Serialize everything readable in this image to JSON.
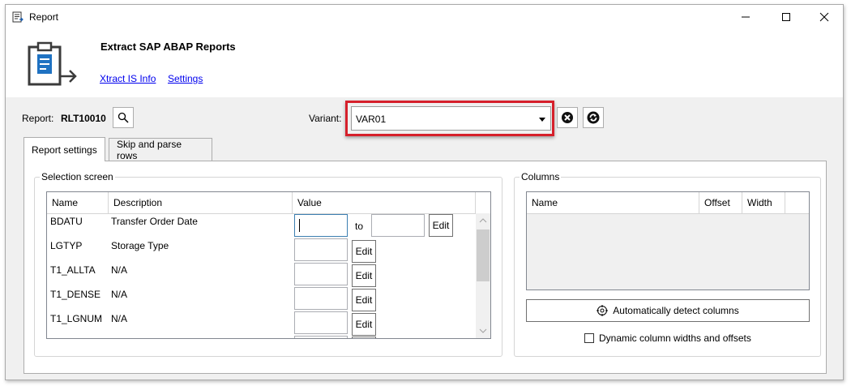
{
  "window": {
    "title": "Report",
    "app_icon": "report-icon"
  },
  "header": {
    "title": "Extract SAP ABAP Reports",
    "links": [
      "Xtract IS Info",
      "Settings"
    ],
    "icon": "clipboard-arrow-icon"
  },
  "report": {
    "label": "Report:",
    "value": "RLT10010",
    "search_icon": "search-icon"
  },
  "variant": {
    "label": "Variant:",
    "value": "VAR01",
    "highlight_color": "#d6202b"
  },
  "tabs": [
    "Report settings",
    "Skip and parse rows"
  ],
  "selection": {
    "title": "Selection screen",
    "columns": [
      "Name",
      "Description",
      "Value"
    ],
    "to_label": "to",
    "edit_label": "Edit",
    "rows": [
      {
        "name": "BDATU",
        "description": "Transfer Order Date",
        "range": true
      },
      {
        "name": "LGTYP",
        "description": "Storage Type"
      },
      {
        "name": "T1_ALLTA",
        "description": "N/A"
      },
      {
        "name": "T1_DENSE",
        "description": "N/A"
      },
      {
        "name": "T1_LGNUM",
        "description": "N/A"
      }
    ]
  },
  "columns_panel": {
    "title": "Columns",
    "columns": [
      "Name",
      "Offset",
      "Width"
    ],
    "detect_button": "Automatically detect columns",
    "dynamic_checkbox": {
      "label": "Dynamic column widths and offsets",
      "checked": false
    }
  },
  "colors": {
    "link": "#0000ee",
    "window_bg": "#f0f0f0"
  }
}
